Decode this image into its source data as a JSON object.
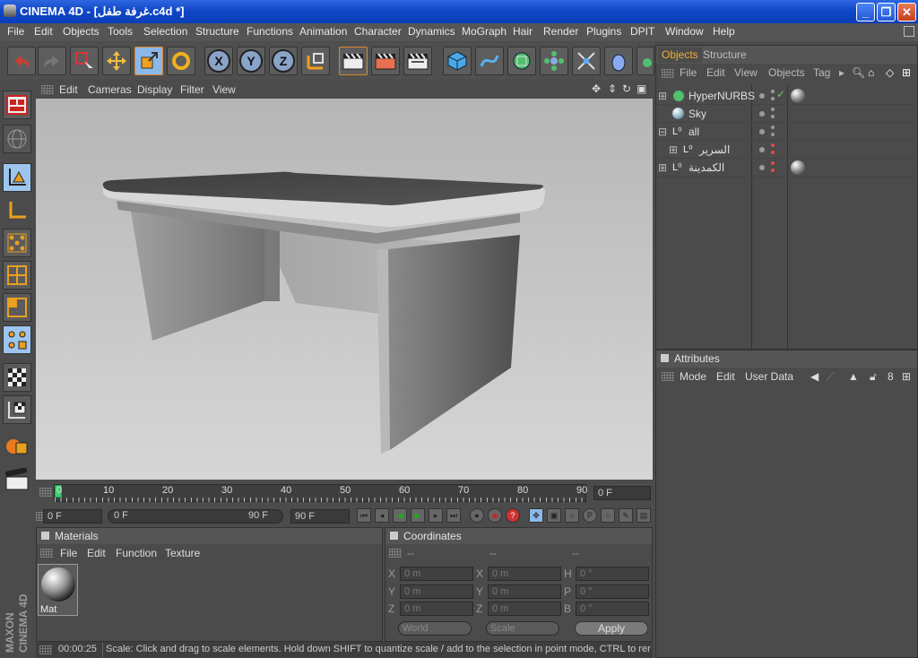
{
  "window": {
    "title": "CINEMA 4D - [غرفة طفل.c4d *]",
    "minimize": "_",
    "maximize": "❐",
    "close": "✕"
  },
  "menu": [
    "File",
    "Edit",
    "Objects",
    "Tools",
    "Selection",
    "Structure",
    "Functions",
    "Animation",
    "Character",
    "Dynamics",
    "MoGraph",
    "Hair",
    "Render",
    "Plugins",
    "DPIT",
    "Window",
    "Help"
  ],
  "toolbar": {
    "axis_x": "X",
    "axis_y": "Y",
    "axis_z": "Z"
  },
  "viewport": {
    "menu": [
      "Edit",
      "Cameras",
      "Display",
      "Filter",
      "View"
    ]
  },
  "timeline": {
    "ticks": [
      "0",
      "10",
      "20",
      "30",
      "40",
      "50",
      "60",
      "70",
      "80",
      "90"
    ],
    "current_frame": "0 F"
  },
  "transport": {
    "start": "0 F",
    "range_start": "0 F",
    "range_end": "90 F",
    "end": "90 F"
  },
  "materials": {
    "title": "Materials",
    "menu": [
      "File",
      "Edit",
      "Function",
      "Texture"
    ],
    "items": [
      {
        "name": "Mat"
      }
    ]
  },
  "coordinates": {
    "title": "Coordinates",
    "col_heads": [
      "--",
      "--",
      "--"
    ],
    "rows": [
      {
        "l1": "X",
        "v1": "0 m",
        "l2": "X",
        "v2": "0 m",
        "l3": "H",
        "v3": "0 °"
      },
      {
        "l1": "Y",
        "v1": "0 m",
        "l2": "Y",
        "v2": "0 m",
        "l3": "P",
        "v3": "0 °"
      },
      {
        "l1": "Z",
        "v1": "0 m",
        "l2": "Z",
        "v2": "0 m",
        "l3": "B",
        "v3": "0 °"
      }
    ],
    "mode": "World",
    "size_mode": "Scale",
    "apply": "Apply"
  },
  "status": {
    "time": "00:00:25",
    "message": "Scale: Click and drag to scale elements. Hold down SHIFT to quantize scale / add to the selection in point mode, CTRL to remove"
  },
  "objects": {
    "tabs": [
      "Objects",
      "Structure"
    ],
    "menu": [
      "File",
      "Edit",
      "View",
      "Objects",
      "Tags"
    ],
    "items": [
      {
        "name": "HyperNURBS"
      },
      {
        "name": "Sky"
      },
      {
        "name": "all"
      },
      {
        "name": "السرير"
      },
      {
        "name": "الكمدينة"
      }
    ]
  },
  "attributes": {
    "title": "Attributes",
    "menu": [
      "Mode",
      "Edit",
      "User Data"
    ]
  },
  "brand": {
    "line1": "MAXON",
    "line2": "CINEMA 4D"
  },
  "colors": {
    "title_bar": "#1048c8",
    "accent": "#e8a23a",
    "panel": "#4b4b4b"
  }
}
